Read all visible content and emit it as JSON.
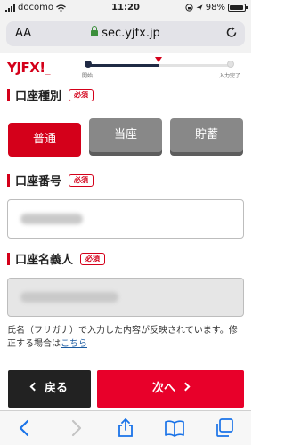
{
  "status_bar": {
    "carrier": "docomo",
    "time": "11:20",
    "battery": "98%"
  },
  "browser": {
    "text_size_label": "AA",
    "url": "sec.yjfx.jp"
  },
  "header": {
    "logo": "YJFX!",
    "progress": {
      "start_label": "開始",
      "end_label": "入力完了",
      "fraction": 0.5
    }
  },
  "account_type": {
    "heading": "口座種別",
    "required": "必須",
    "options": [
      "普通",
      "当座",
      "貯蓄"
    ],
    "selected": "普通"
  },
  "account_number": {
    "heading": "口座番号",
    "required": "必須"
  },
  "account_holder": {
    "heading": "口座名義人",
    "required": "必須"
  },
  "note": {
    "text": "氏名（フリガナ）で入力した内容が反映されています。修正する場合は",
    "link": "こちら"
  },
  "footer": {
    "back_label": "戻る",
    "next_label": "次へ"
  },
  "toolbar": {
    "icons": [
      "back-icon",
      "forward-icon",
      "share-icon",
      "bookmarks-icon",
      "tabs-icon"
    ]
  },
  "colors": {
    "brand_red": "#d4001a",
    "next_red": "#e8002a",
    "dark": "#222222",
    "link": "#1a5aa0"
  }
}
